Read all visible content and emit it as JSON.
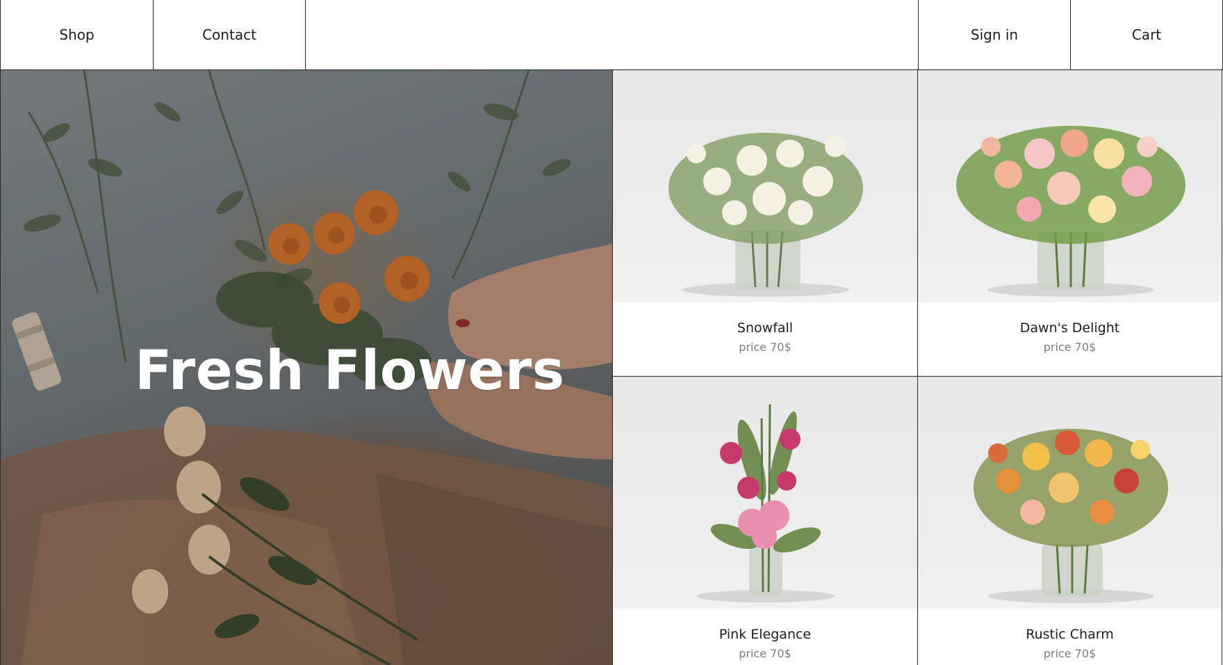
{
  "nav": {
    "shop": "Shop",
    "contact": "Contact",
    "signin": "Sign in",
    "cart": "Cart"
  },
  "hero": {
    "title": "Fresh Flowers"
  },
  "products": [
    {
      "name": "Snowfall",
      "price": "price 70$"
    },
    {
      "name": "Dawn's Delight",
      "price": "price 70$"
    },
    {
      "name": "Pink Elegance",
      "price": "price 70$"
    },
    {
      "name": "Rustic Charm",
      "price": "price 70$"
    }
  ],
  "colors": {
    "border": "#2a2a2a",
    "text": "#1d1d1d",
    "price_text": "#7d7d7d",
    "hero_text": "#ffffff"
  }
}
